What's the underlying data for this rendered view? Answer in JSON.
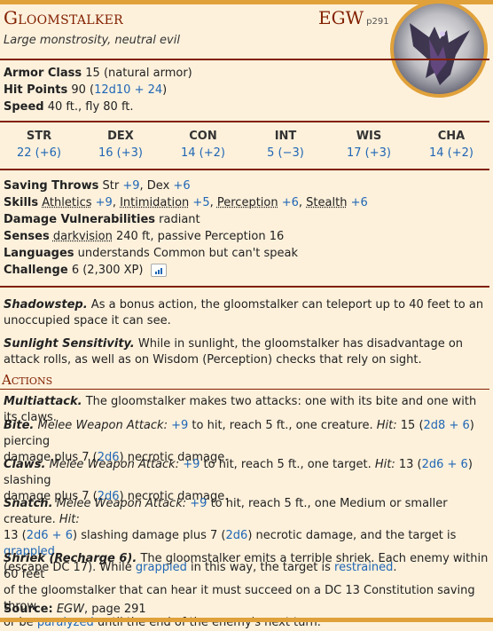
{
  "monster": {
    "name": "Gloomstalker",
    "source_abbr": "EGW",
    "source_page": "p291",
    "subtitle": "Large monstrosity, neutral evil"
  },
  "stats": {
    "ac_label": "Armor Class",
    "ac_value": "15 (natural armor)",
    "hp_label": "Hit Points",
    "hp_value": "90",
    "hp_dice": "12d10 + 24",
    "speed_label": "Speed",
    "speed_value": "40 ft., fly 80 ft."
  },
  "abilities": [
    {
      "label": "STR",
      "value": "22 (+6)"
    },
    {
      "label": "DEX",
      "value": "16 (+3)"
    },
    {
      "label": "CON",
      "value": "14 (+2)"
    },
    {
      "label": "INT",
      "value": "5 (−3)"
    },
    {
      "label": "WIS",
      "value": "17 (+3)"
    },
    {
      "label": "CHA",
      "value": "14 (+2)"
    }
  ],
  "details": {
    "saves_label": "Saving Throws",
    "saves_str": "Str",
    "saves_str_mod": "+9",
    "saves_dex": ", Dex",
    "saves_dex_mod": "+6",
    "skills_label": "Skills",
    "skill_1": "Athletics",
    "skill_1_mod": "+9",
    "skill_2": "Intimidation",
    "skill_2_mod": "+5",
    "skill_3": "Perception",
    "skill_3_mod": "+6",
    "skill_4": "Stealth",
    "skill_4_mod": "+6",
    "vuln_label": "Damage Vulnerabilities",
    "vuln_value": "radiant",
    "senses_label": "Senses",
    "senses_dark": "darkvision",
    "senses_rest": "240 ft, passive Perception 16",
    "lang_label": "Languages",
    "lang_value": "understands Common but can't speak",
    "cr_label": "Challenge",
    "cr_value": "6 (2,300 XP)"
  },
  "traits": [
    {
      "name": "Shadowstep.",
      "text": "As a bonus action, the gloomstalker can teleport up to 40 feet to an unoccupied space it can see."
    },
    {
      "name": "Sunlight Sensitivity.",
      "text": "While in sunlight, the gloomstalker has disadvantage on attack rolls, as well as on Wisdom (Perception) checks that rely on sight."
    }
  ],
  "actions_header": "Actions",
  "actions": {
    "multi_name": "Multiattack.",
    "multi_text": "The gloomstalker makes two attacks: one with its bite and one with its claws.",
    "bite_name": "Bite.",
    "bite_type": "Melee Weapon Attack:",
    "bite_bonus": "+9",
    "bite_mid": "to hit, reach 5 ft., one creature.",
    "bite_hit": "Hit:",
    "bite_dmg1": "15 (",
    "bite_dice1": "2d8 + 6",
    "bite_dmg1b": ") piercing",
    "bite_line2a": "damage plus 7 (",
    "bite_dice2": "2d6",
    "bite_line2b": ") necrotic damage.",
    "claws_name": "Claws.",
    "claws_type": "Melee Weapon Attack:",
    "claws_bonus": "+9",
    "claws_mid": "to hit, reach 5 ft., one target.",
    "claws_hit": "Hit:",
    "claws_dmg1": "13 (",
    "claws_dice1": "2d6 + 6",
    "claws_dmg1b": ") slashing",
    "claws_line2a": "damage plus 7 (",
    "claws_dice2": "2d6",
    "claws_line2b": ") necrotic damage.",
    "snatch_name": "Snatch.",
    "snatch_type": "Melee Weapon Attack:",
    "snatch_bonus": "+9",
    "snatch_mid": "to hit, reach 5 ft., one Medium or smaller creature.",
    "snatch_hit": "Hit:",
    "snatch_l2a": "13 (",
    "snatch_dice1": "2d6 + 6",
    "snatch_l2b": ") slashing damage plus 7 (",
    "snatch_dice2": "2d6",
    "snatch_l2c": ") necrotic damage, and the target is",
    "snatch_grappled": "grappled",
    "snatch_l3a": "(escape DC 17). While",
    "snatch_grappled2": "grappled",
    "snatch_l3b": "in this way, the target is",
    "snatch_restrained": "restrained",
    "snatch_l3c": ".",
    "shriek_name": "Shriek (Recharge 6).",
    "shriek_l1": "The gloomstalker emits a terrible shriek. Each enemy within 60 feet",
    "shriek_l2": "of the gloomstalker that can hear it must succeed on a DC 13 Constitution saving throw",
    "shriek_l3a": "or be",
    "shriek_paralyzed": "paralyzed",
    "shriek_l3b": "until the end of the enemy's next turn."
  },
  "source": {
    "label": "Source:",
    "book": "EGW",
    "page": ", page 291"
  },
  "colors": {
    "accent": "#822000",
    "gold": "#e0a13a",
    "link": "#1f66b5",
    "background": "#fdf1dc"
  }
}
